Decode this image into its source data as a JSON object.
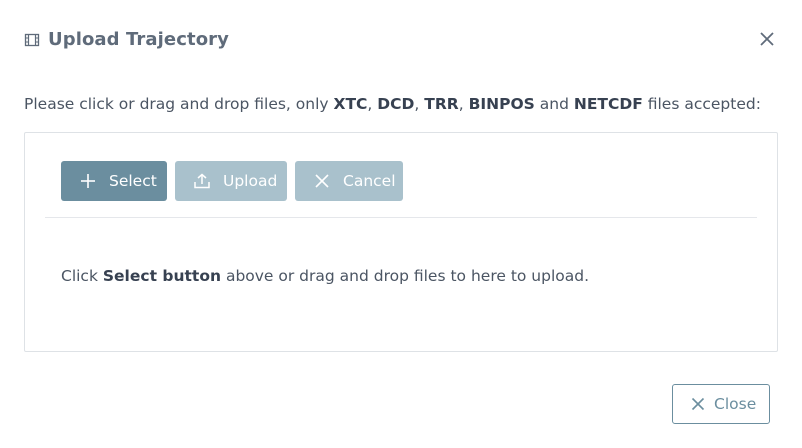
{
  "dialog": {
    "title": "Upload Trajectory",
    "title_icon": "film-icon",
    "close_icon": "close-icon"
  },
  "instructions": {
    "prefix": "Please click or drag and drop files, only ",
    "formats": [
      "XTC",
      "DCD",
      "TRR",
      "BINPOS",
      "NETCDF"
    ],
    "sep1": ", ",
    "sep2": ", ",
    "sep3": ", ",
    "and_word": " and ",
    "suffix": " files accepted:"
  },
  "uploader": {
    "select_label": "Select",
    "select_icon": "plus-icon",
    "upload_label": "Upload",
    "upload_icon": "upload-icon",
    "cancel_label": "Cancel",
    "cancel_icon": "close-icon",
    "hint_prefix": "Click ",
    "hint_bold": "Select button",
    "hint_suffix": " above or drag and drop files to here to upload."
  },
  "footer": {
    "close_label": "Close",
    "close_icon": "close-icon"
  },
  "colors": {
    "primary": "#6b8e9f",
    "primary_disabled": "#a9c1cc",
    "text": "#4b5563",
    "border": "#dee2e6"
  }
}
